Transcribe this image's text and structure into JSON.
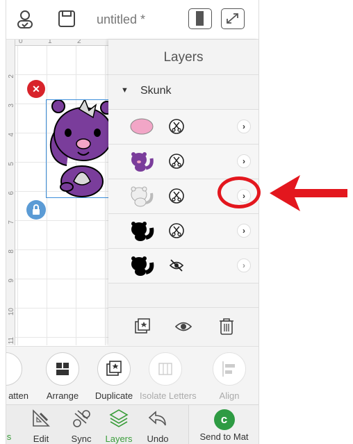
{
  "header": {
    "title": "untitled *",
    "icons": [
      "account-icon",
      "save-icon",
      "split-view-icon",
      "expand-icon"
    ]
  },
  "canvas": {
    "ruler_top": [
      "0",
      "1",
      "2"
    ],
    "ruler_left": [
      "2",
      "3",
      "4",
      "5",
      "6",
      "7",
      "8",
      "9",
      "10",
      "11"
    ]
  },
  "layers_panel": {
    "title": "Layers",
    "group_name": "Skunk",
    "layers": [
      {
        "thumb": "pink-oval",
        "operation": "cut-icon",
        "visible": true
      },
      {
        "thumb": "purple-skunk",
        "operation": "cut-icon",
        "visible": true
      },
      {
        "thumb": "gray-skunk",
        "operation": "cut-icon",
        "visible": true,
        "highlighted": true
      },
      {
        "thumb": "black-skunk",
        "operation": "cut-icon",
        "visible": true
      },
      {
        "thumb": "black-skunk",
        "operation": "hidden-icon",
        "visible": false
      }
    ],
    "bottom_icons": [
      "duplicate-layer-icon",
      "visibility-eye-icon",
      "trash-icon"
    ]
  },
  "toolbar": {
    "items": [
      {
        "label": "atten",
        "enabled": true
      },
      {
        "label": "Arrange",
        "enabled": true
      },
      {
        "label": "Duplicate",
        "enabled": true
      },
      {
        "label": "Isolate Letters",
        "enabled": false
      },
      {
        "label": "Align",
        "enabled": false
      }
    ]
  },
  "nav": {
    "items": [
      "s",
      "Edit",
      "Sync",
      "Layers",
      "Undo"
    ],
    "active": "Layers",
    "send_label": "Send to Mat"
  },
  "colors": {
    "accent_green": "#3a9d3a",
    "annotation_red": "#e3171e",
    "delete_red": "#d8232a",
    "lock_blue": "#5b9bd5",
    "skunk_purple": "#7a3d9b"
  }
}
